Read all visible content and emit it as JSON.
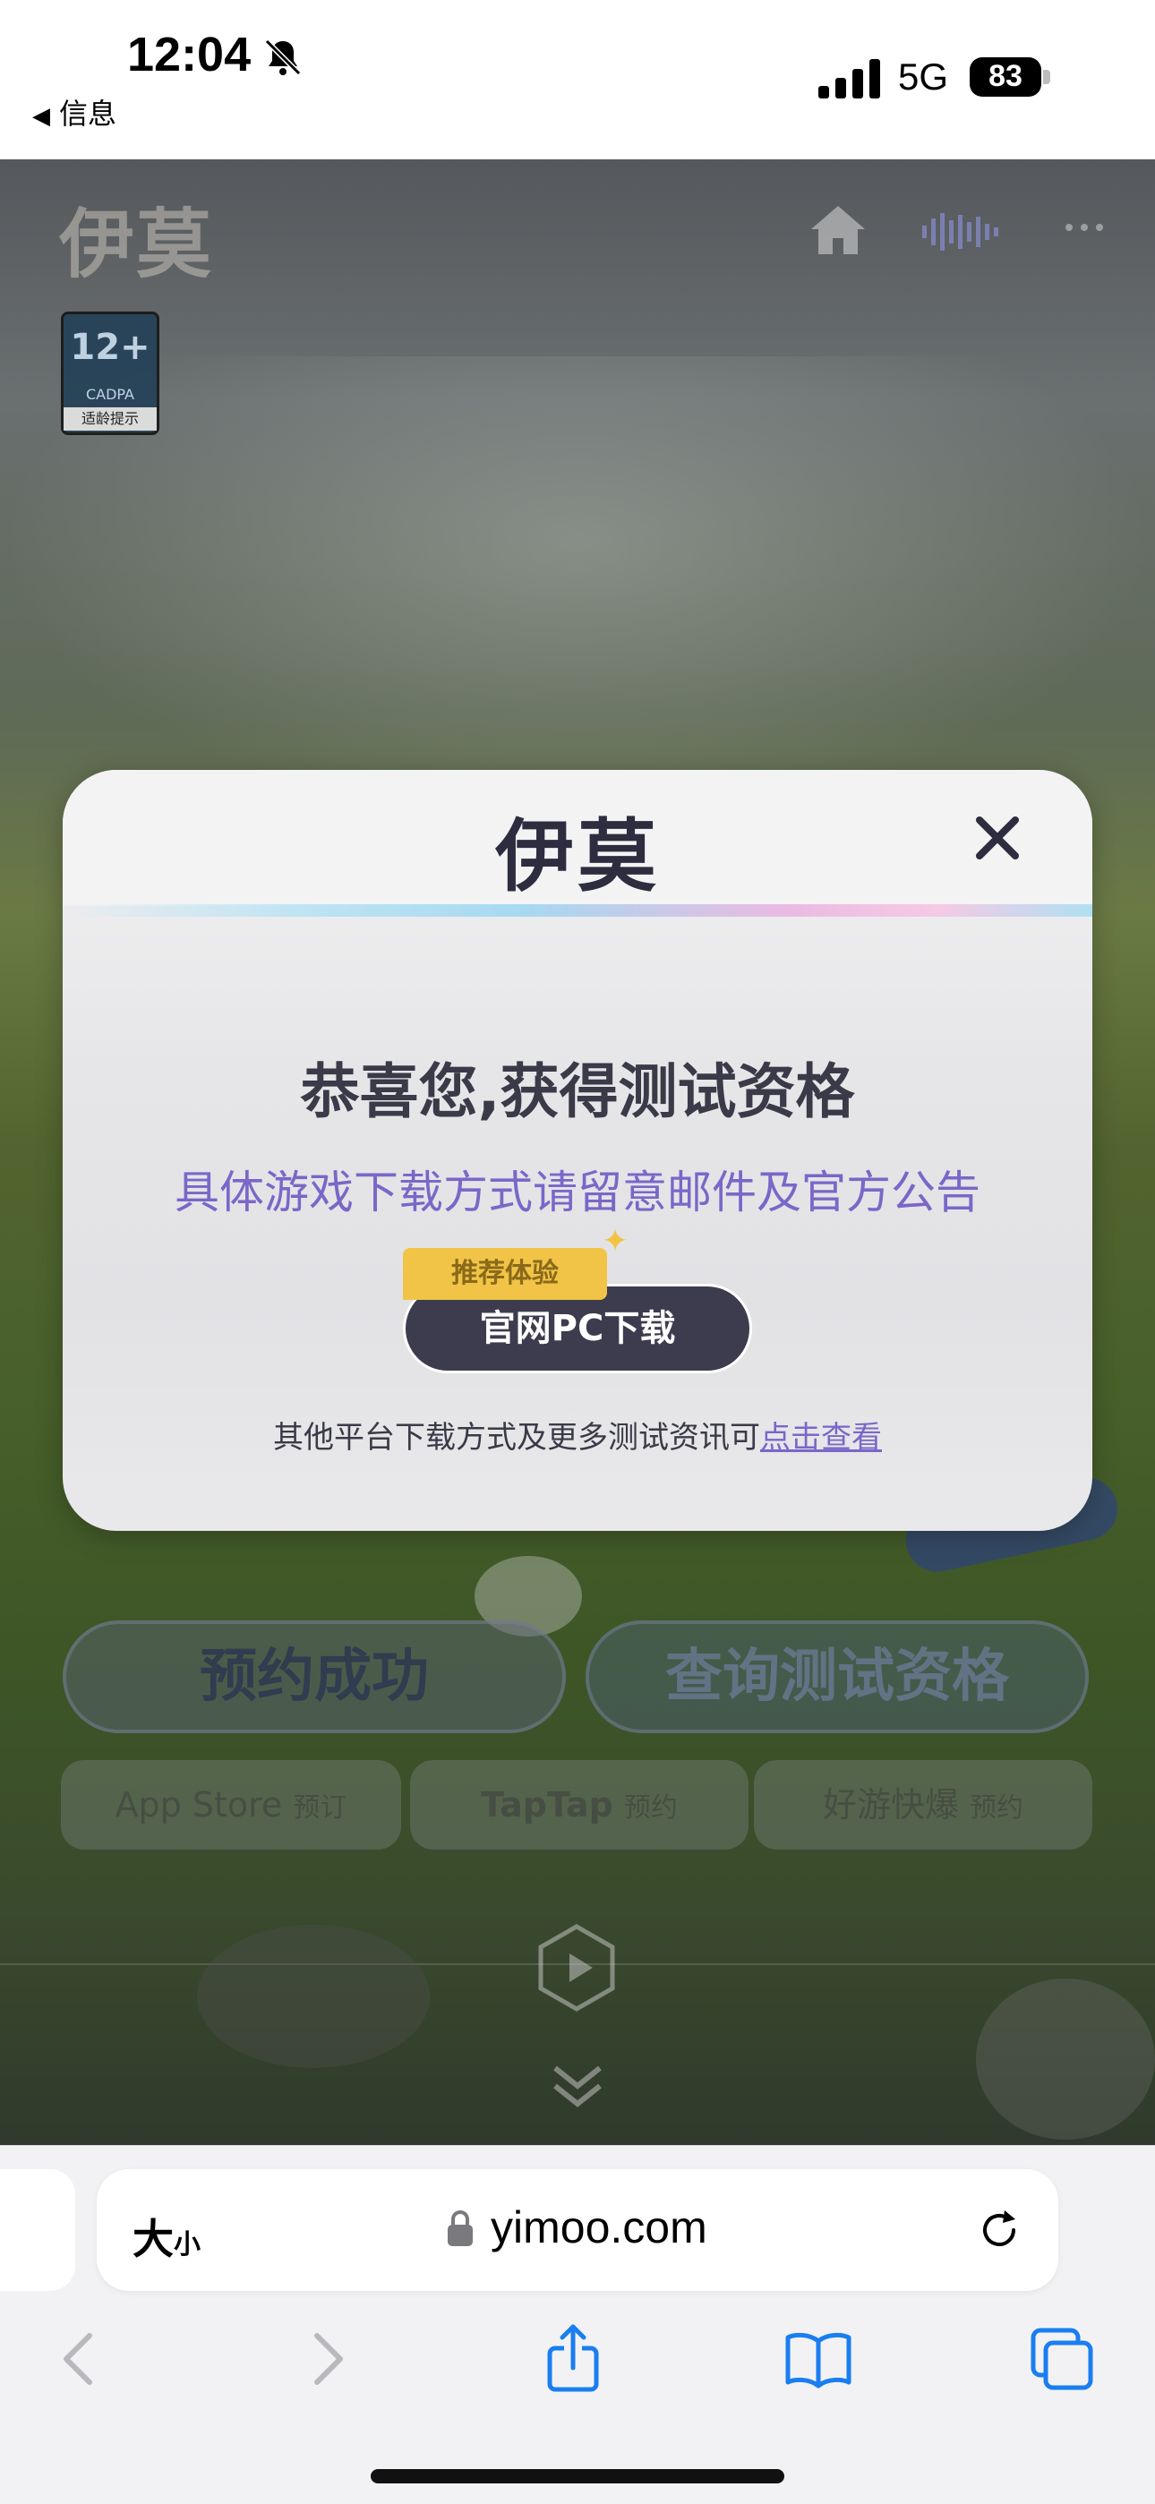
{
  "status_bar": {
    "time": "12:04",
    "back_app": "信息",
    "network": "5G",
    "battery": "83",
    "icons": [
      "bell-slash-icon",
      "cellular-signal-icon",
      "battery-icon"
    ]
  },
  "page": {
    "logo": "伊莫",
    "age_badge": {
      "rating": "12+",
      "org": "CADPA",
      "tip": "适龄提示"
    },
    "reserve_button": "预约成功",
    "query_button": "查询测试资格",
    "store_buttons": [
      {
        "name": "App Store",
        "action": "预订"
      },
      {
        "name": "TapTap",
        "action": "预约"
      },
      {
        "name": "好游快爆",
        "action": "预约"
      }
    ],
    "icons": [
      "home-icon",
      "music-wave-icon",
      "more-icon",
      "play-icon",
      "chevron-double-down-icon"
    ]
  },
  "modal": {
    "logo": "伊莫",
    "title": "恭喜您,获得测试资格",
    "subtitle": "具体游戏下载方式请留意邮件及官方公告",
    "badge": "推荐体验",
    "download_button": "官网PC下载",
    "more_text": "其他平台下载方式及更多测试资讯可",
    "more_link": "点击查看",
    "colors": {
      "accent": "#7a67c8",
      "button": "#3d3b4e",
      "badge": "#f1c447"
    }
  },
  "browser": {
    "text_size_label": "大",
    "text_size_small": "小",
    "url": "yimoo.com",
    "icons": [
      "lock-icon",
      "reload-icon",
      "back-icon",
      "forward-icon",
      "share-icon",
      "bookmarks-icon",
      "tabs-icon"
    ]
  }
}
